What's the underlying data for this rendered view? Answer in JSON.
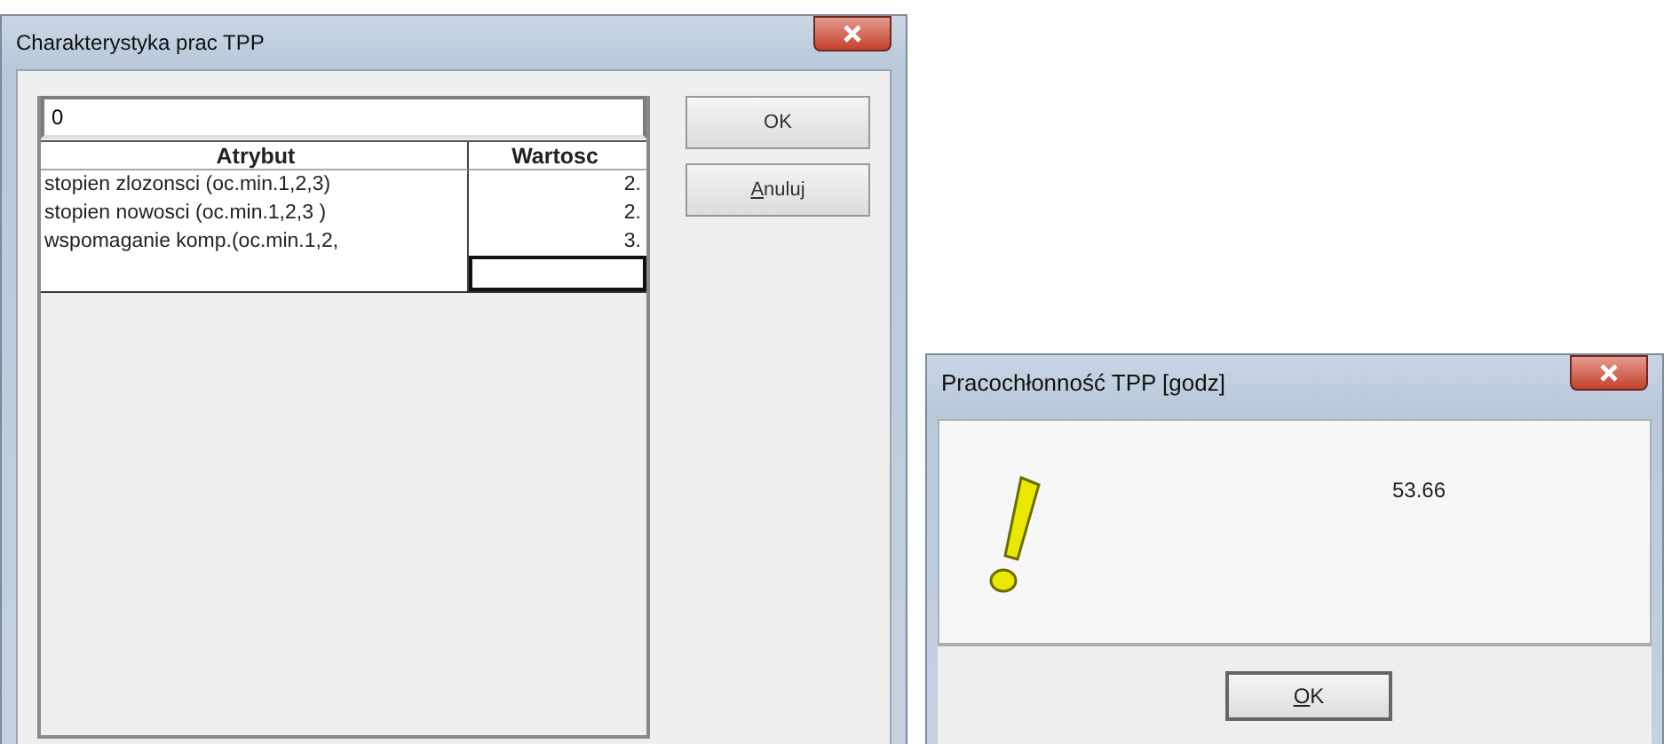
{
  "main_window": {
    "title": "Charakterystyka prac TPP",
    "input_value": "0",
    "table": {
      "columns": [
        "Atrybut",
        "Wartosc"
      ],
      "rows": [
        {
          "attribute": "stopien zlozonsci (oc.min.1,2,3)",
          "value": "2."
        },
        {
          "attribute": "stopien nowosci (oc.min.1,2,3 )",
          "value": "2."
        },
        {
          "attribute": "wspomaganie komp.(oc.min.1,2,",
          "value": "3."
        }
      ],
      "new_row": {
        "value_focused": true
      }
    },
    "buttons": [
      "OK",
      "Anuluj"
    ]
  },
  "message_box": {
    "title": "Pracochłonność TPP [godz]",
    "message": "53.66",
    "button": "OK"
  }
}
